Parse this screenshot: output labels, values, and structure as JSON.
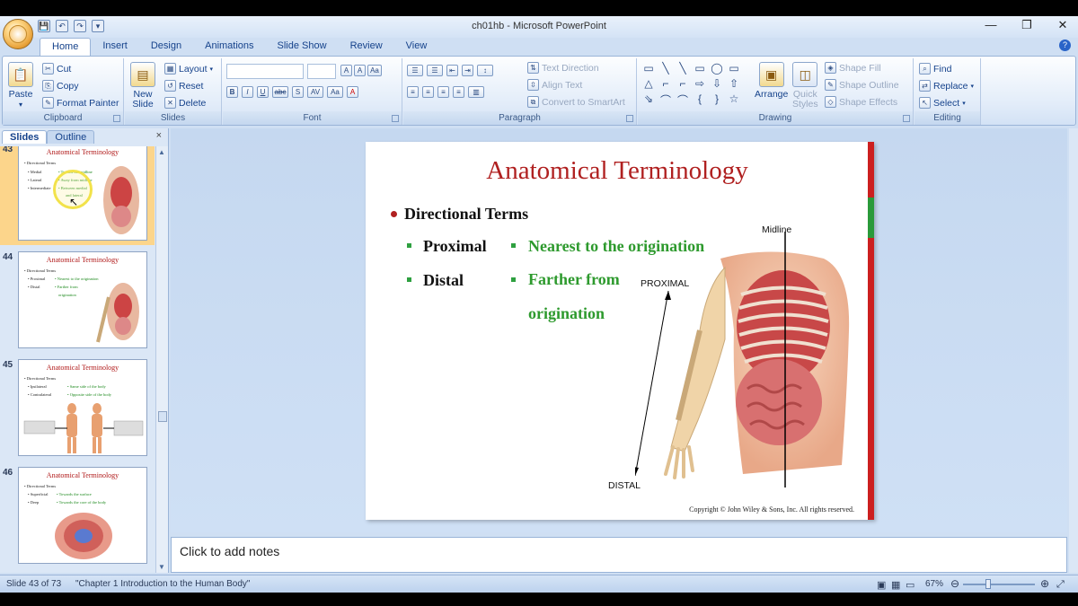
{
  "window": {
    "title": "ch01hb - Microsoft PowerPoint",
    "minimize": "—",
    "restore": "❐",
    "close": "✕"
  },
  "qat": {
    "save": "💾",
    "undo": "↶",
    "redo": "↷",
    "more": "▾"
  },
  "tabs": [
    "Home",
    "Insert",
    "Design",
    "Animations",
    "Slide Show",
    "Review",
    "View"
  ],
  "help": "?",
  "ribbon": {
    "clipboard": {
      "paste": "Paste",
      "cut": "Cut",
      "copy": "Copy",
      "format_painter": "Format Painter",
      "label": "Clipboard"
    },
    "slides": {
      "new_slide_1": "New",
      "new_slide_2": "Slide",
      "layout": "Layout",
      "reset": "Reset",
      "delete": "Delete",
      "label": "Slides"
    },
    "font": {
      "label": "Font",
      "bold": "B",
      "italic": "I",
      "underline": "U",
      "strike": "abc",
      "shadow": "S",
      "spacing": "AV",
      "case": "Aa",
      "color": "A",
      "grow": "A",
      "shrink": "A",
      "clear": "Aa"
    },
    "paragraph": {
      "label": "Paragraph",
      "text_direction": "Text Direction",
      "align_text": "Align Text",
      "convert_smartart": "Convert to SmartArt"
    },
    "drawing": {
      "label": "Drawing",
      "arrange": "Arrange",
      "quick_styles_1": "Quick",
      "quick_styles_2": "Styles",
      "shape_fill": "Shape Fill",
      "shape_outline": "Shape Outline",
      "shape_effects": "Shape Effects",
      "shapes": [
        "▭",
        "╲",
        "╲",
        "▭",
        "◯",
        "▭",
        "△",
        "⌐",
        "⌐",
        "⇨",
        "⇩",
        "⇧",
        "⇘",
        "⌒",
        "⌒",
        "{",
        "}",
        "☆"
      ]
    },
    "editing": {
      "label": "Editing",
      "find": "Find",
      "replace": "Replace",
      "select": "Select"
    }
  },
  "pane": {
    "tab_slides": "Slides",
    "tab_outline": "Outline",
    "close": "×"
  },
  "thumbnails": [
    {
      "num": "43",
      "title": "Anatomical Terminology",
      "lines": [
        "• Directional Terms",
        "• Medial",
        "• Lateral",
        "• Intermediate"
      ],
      "green": [
        "• Toward the midline",
        "• Away from midline",
        "• Between medial",
        "and lateral"
      ]
    },
    {
      "num": "44",
      "title": "Anatomical Terminology",
      "lines": [
        "• Directional Terms",
        "• Proximal",
        "• Distal"
      ],
      "green": [
        "• Nearest to the origination",
        "• Farther from",
        "origination"
      ]
    },
    {
      "num": "45",
      "title": "Anatomical Terminology",
      "lines": [
        "• Directional Terms",
        "• Ipsilateral",
        "• Contralateral"
      ],
      "green": [
        "• Same side of the body",
        "• Opposite side of the body"
      ]
    },
    {
      "num": "46",
      "title": "Anatomical Terminology",
      "lines": [
        "• Directional Terms",
        "• Superficial",
        "• Deep"
      ],
      "green": [
        "• Towards the surface",
        "• Towards the core of the body"
      ]
    }
  ],
  "slide": {
    "title": "Anatomical Terminology",
    "heading": "Directional Terms",
    "terms": [
      {
        "term": "Proximal",
        "definition": "Nearest to the origination"
      },
      {
        "term": "Distal",
        "definition_1": "Farther from",
        "definition_2": "origination"
      }
    ],
    "figure": {
      "midline": "Midline",
      "proximal": "PROXIMAL",
      "distal": "DISTAL"
    },
    "copyright": "Copyright © John Wiley & Sons, Inc. All rights reserved."
  },
  "notes": {
    "placeholder": "Click to add notes"
  },
  "status": {
    "slide_info": "Slide 43 of 73",
    "theme": "\"Chapter 1 Introduction to the Human Body\"",
    "zoom": "67%"
  },
  "colors": {
    "title_red": "#b02020",
    "definition_green": "#2e9a2e",
    "accent_bar_red": "#cc1f1f",
    "accent_bar_green": "#2a9a3a"
  }
}
